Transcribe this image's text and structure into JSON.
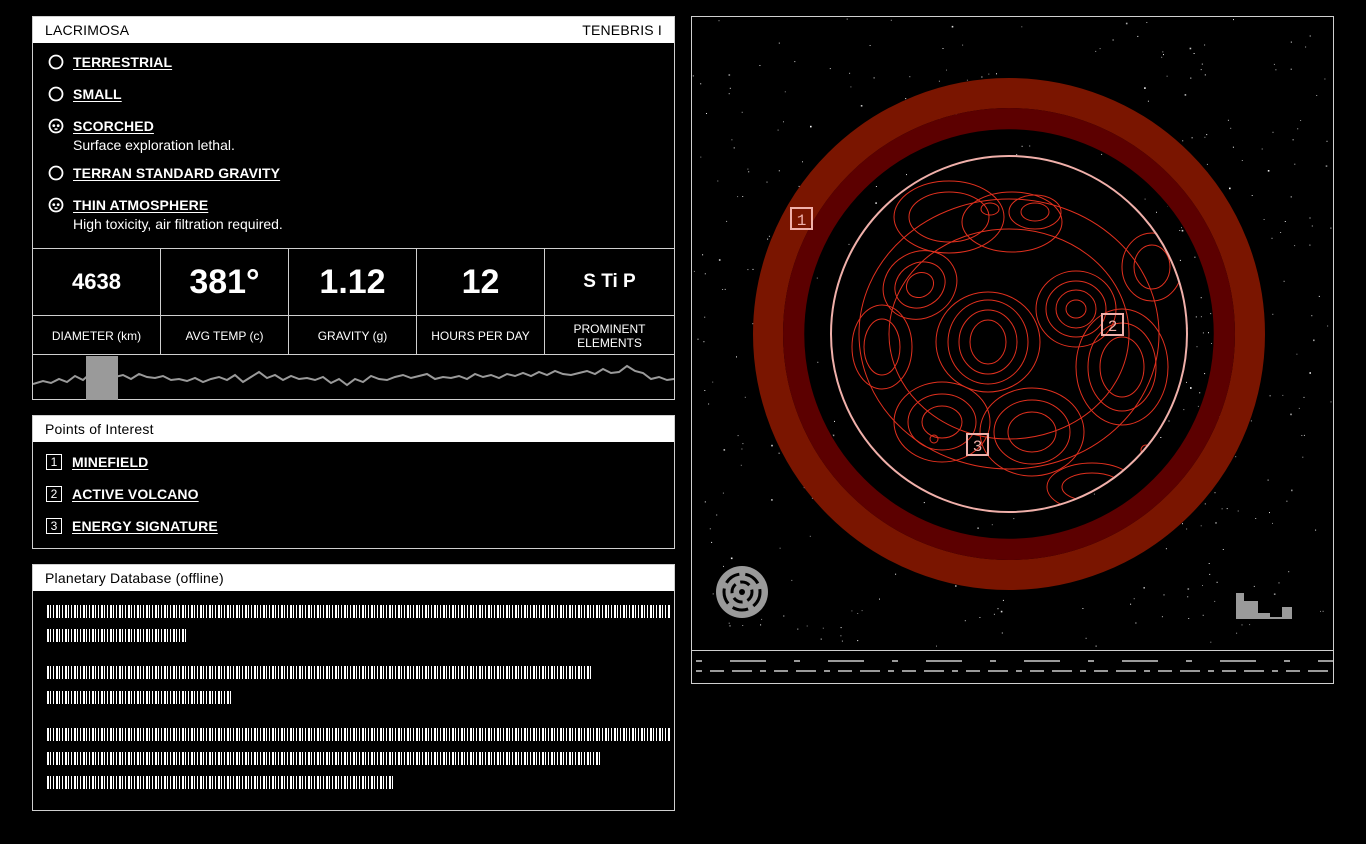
{
  "planet": {
    "name": "LACRIMOSA",
    "system": "TENEBRIS I"
  },
  "traits": [
    {
      "name": "TERRESTRIAL",
      "desc": "",
      "icon": "circle-icon"
    },
    {
      "name": "SMALL",
      "desc": "",
      "icon": "circle-icon"
    },
    {
      "name": "SCORCHED",
      "desc": "Surface exploration lethal.",
      "icon": "skull-icon"
    },
    {
      "name": "TERRAN STANDARD GRAVITY",
      "desc": "",
      "icon": "circle-icon"
    },
    {
      "name": "THIN ATMOSPHERE",
      "desc": "High toxicity, air filtration required.",
      "icon": "skull-icon"
    }
  ],
  "stats": [
    {
      "value": "4638",
      "label": "DIAMETER (km)"
    },
    {
      "value": "381°",
      "label": "AVG TEMP (c)"
    },
    {
      "value": "1.12",
      "label": "GRAVITY (g)"
    },
    {
      "value": "12",
      "label": "HOURS PER DAY"
    },
    {
      "value": "S Ti P",
      "label": "PROMINENT ELEMENTS"
    }
  ],
  "poi": {
    "title": "Points of Interest",
    "items": [
      {
        "num": "1",
        "label": "MINEFIELD"
      },
      {
        "num": "2",
        "label": "ACTIVE VOLCANO"
      },
      {
        "num": "3",
        "label": "ENERGY SIGNATURE"
      }
    ]
  },
  "database": {
    "title": "Planetary Database (offline)"
  },
  "colors": {
    "atmosphere_outer": "#7a1500",
    "atmosphere_inner": "#5c0000",
    "planet_rim": "#f0b0aa",
    "contours": "#e0301e",
    "panel_border": "#cfcfcf"
  }
}
